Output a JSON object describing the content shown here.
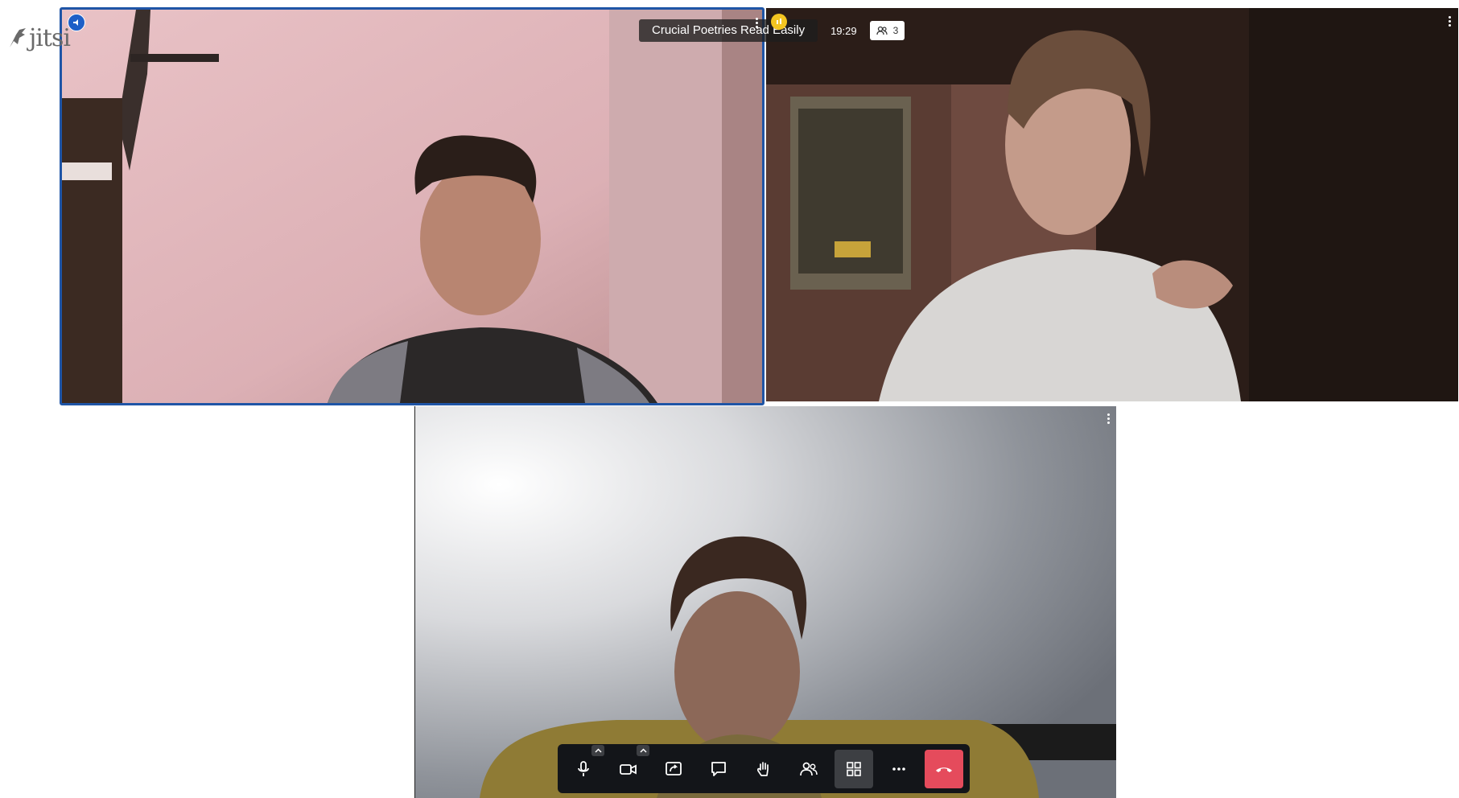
{
  "app": {
    "logo_text": "jitsi"
  },
  "conference": {
    "subject": "Crucial Poetries Read Easily",
    "timer": "19:29",
    "participants_count": "3"
  },
  "tiles": [
    {
      "id": "participant-1",
      "dominant_speaker": true
    },
    {
      "id": "participant-2",
      "dominant_speaker": false
    },
    {
      "id": "participant-3",
      "dominant_speaker": false
    }
  ],
  "toolbar": {
    "buttons": [
      {
        "name": "microphone",
        "icon": "microphone-icon",
        "has_options": true
      },
      {
        "name": "camera",
        "icon": "camera-icon",
        "has_options": true
      },
      {
        "name": "share-screen",
        "icon": "share-screen-icon",
        "has_options": false
      },
      {
        "name": "chat",
        "icon": "chat-icon",
        "has_options": false
      },
      {
        "name": "raise-hand",
        "icon": "raise-hand-icon",
        "has_options": false
      },
      {
        "name": "participants",
        "icon": "participants-icon",
        "has_options": false
      },
      {
        "name": "tile-view",
        "icon": "tile-view-icon",
        "has_options": false,
        "active": true
      },
      {
        "name": "more-actions",
        "icon": "more-actions-icon",
        "has_options": false
      },
      {
        "name": "leave",
        "icon": "hangup-icon",
        "has_options": false
      }
    ]
  },
  "colors": {
    "dominant_speaker_border": "#1f55a6",
    "toolbar_background": "#131519",
    "hangup_red": "#e54b5c",
    "status_yellow": "#f3c521"
  }
}
